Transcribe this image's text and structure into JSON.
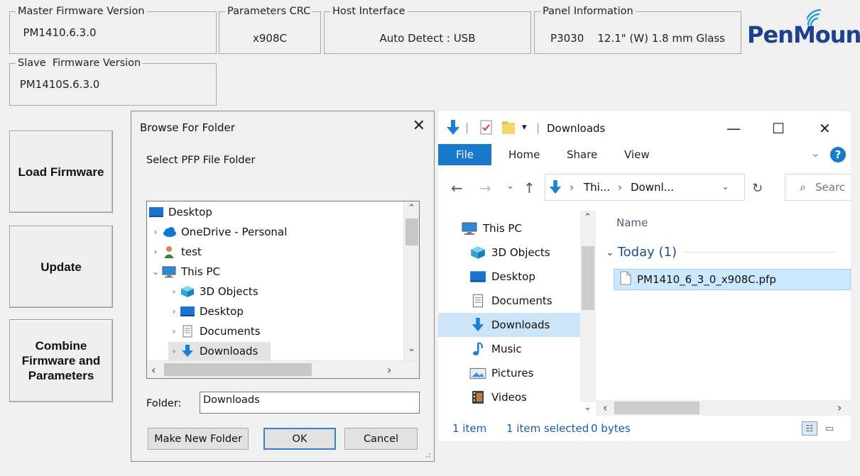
{
  "info": {
    "master_title": "Master Firmware Version",
    "master_value": "PM1410.6.3.0",
    "crc_title": "Parameters CRC",
    "crc_value": "x908C",
    "host_title": "Host Interface",
    "host_value": "Auto Detect : USB",
    "panel_title": "Panel Information",
    "panel_value": "P3030    12.1\" (W) 1.8 mm Glass",
    "slave_title": "Slave  Firmware Version",
    "slave_value": "PM1410S.6.3.0"
  },
  "logo": {
    "text": "PenMount",
    "color": "#1f3f8f"
  },
  "buttons": {
    "load": "Load Firmware",
    "update": "Update",
    "combine": "Combine Firmware and Parameters"
  },
  "dialog": {
    "title": "Browse For Folder",
    "description": "Select PFP File Folder",
    "tree": [
      {
        "label": "Desktop",
        "icon": "desktop-icon"
      },
      {
        "label": "OneDrive - Personal",
        "icon": "cloud-icon"
      },
      {
        "label": "test",
        "icon": "user-icon"
      },
      {
        "label": "This PC",
        "icon": "computer-icon"
      },
      {
        "label": "3D Objects",
        "icon": "cube-icon"
      },
      {
        "label": "Desktop",
        "icon": "desktop-icon"
      },
      {
        "label": "Documents",
        "icon": "document-icon"
      },
      {
        "label": "Downloads",
        "icon": "download-icon"
      }
    ],
    "folder_label": "Folder:",
    "folder_value": "Downloads",
    "make_new_folder": "Make New Folder",
    "ok": "OK",
    "cancel": "Cancel"
  },
  "explorer": {
    "title": "Downloads",
    "tabs": {
      "file": "File",
      "home": "Home",
      "share": "Share",
      "view": "View"
    },
    "address": {
      "part1": "Thi...",
      "part2": "Downl..."
    },
    "search_placeholder": "Searc",
    "nav": [
      {
        "label": "This PC",
        "icon": "computer-icon"
      },
      {
        "label": "3D Objects",
        "icon": "cube-icon"
      },
      {
        "label": "Desktop",
        "icon": "desktop-icon"
      },
      {
        "label": "Documents",
        "icon": "document-icon"
      },
      {
        "label": "Downloads",
        "icon": "download-icon"
      },
      {
        "label": "Music",
        "icon": "music-icon"
      },
      {
        "label": "Pictures",
        "icon": "pictures-icon"
      },
      {
        "label": "Videos",
        "icon": "videos-icon"
      }
    ],
    "column_name": "Name",
    "group": "Today (1)",
    "file": "PM1410_6_3_0_x908C.pfp",
    "status_items": "1 item",
    "status_selected": "1 item selected",
    "status_size": "0 bytes"
  }
}
